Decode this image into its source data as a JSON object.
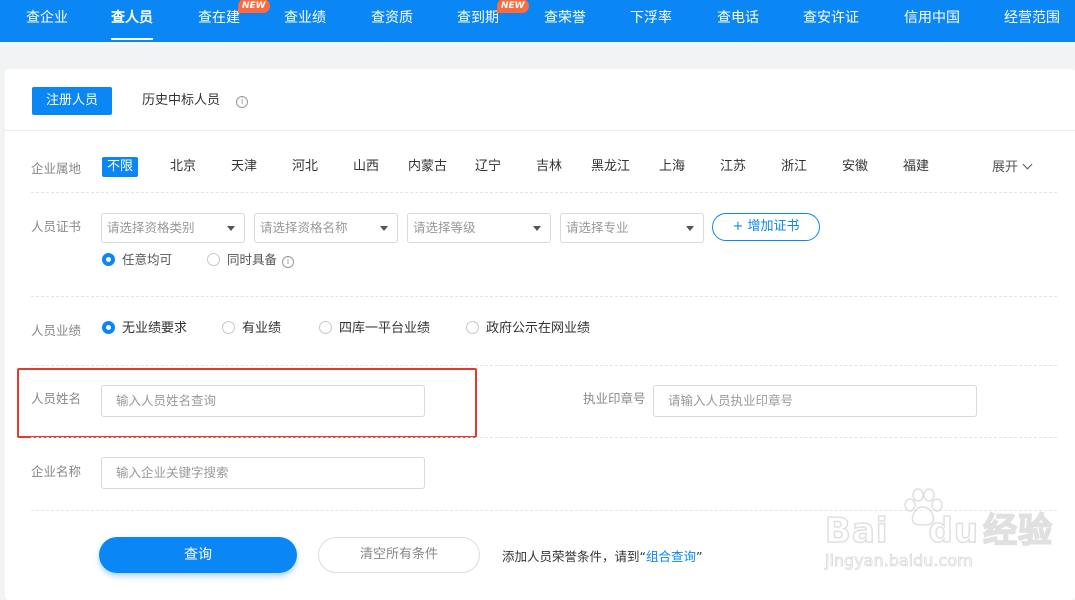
{
  "topnav": {
    "items": [
      {
        "label": "查企业"
      },
      {
        "label": "查人员",
        "active": true
      },
      {
        "label": "查在建",
        "badge": "NEW"
      },
      {
        "label": "查业绩"
      },
      {
        "label": "查资质"
      },
      {
        "label": "查到期",
        "badge": "NEW"
      },
      {
        "label": "查荣誉"
      },
      {
        "label": "下浮率"
      },
      {
        "label": "查电话"
      },
      {
        "label": "查安许证"
      },
      {
        "label": "信用中国"
      },
      {
        "label": "经营范围"
      }
    ],
    "color": "#0a87f5",
    "badge_color": "#ff6a3d"
  },
  "tabs": {
    "active": "注册人员",
    "other": "历史中标人员",
    "info_icon": "info-circle-icon"
  },
  "region": {
    "label": "企业属地",
    "items": [
      "不限",
      "北京",
      "天津",
      "河北",
      "山西",
      "内蒙古",
      "辽宁",
      "吉林",
      "黑龙江",
      "上海",
      "江苏",
      "浙江",
      "安徽",
      "福建"
    ],
    "expand": "展开"
  },
  "cert": {
    "label": "人员证书",
    "selects": [
      "请选择资格类别",
      "请选择资格名称",
      "请选择等级",
      "请选择专业"
    ],
    "add_button": "+ 增加证书",
    "radios": [
      {
        "label": "任意均可",
        "checked": true
      },
      {
        "label": "同时具备",
        "checked": false
      }
    ]
  },
  "performance": {
    "label": "人员业绩",
    "radios": [
      {
        "label": "无业绩要求",
        "checked": true
      },
      {
        "label": "有业绩",
        "checked": false
      },
      {
        "label": "四库一平台业绩",
        "checked": false
      },
      {
        "label": "政府公示在网业绩",
        "checked": false
      }
    ]
  },
  "name_search": {
    "label": "人员姓名",
    "placeholder": "输入人员姓名查询",
    "highlight_color": "#e33b2e"
  },
  "seal_search": {
    "label": "执业印章号",
    "placeholder": "请输入人员执业印章号"
  },
  "company_search": {
    "label": "企业名称",
    "placeholder": "输入企业关键字搜索"
  },
  "actions": {
    "query": "查询",
    "clear": "清空所有条件",
    "hint_prefix": "添加人员荣誉条件，请到“",
    "hint_link": "组合查询",
    "hint_suffix": "”"
  },
  "watermark": {
    "brand": "Bai",
    "brand2": "du",
    "brand3": "经验",
    "url": "jingyan.baidu.com"
  }
}
